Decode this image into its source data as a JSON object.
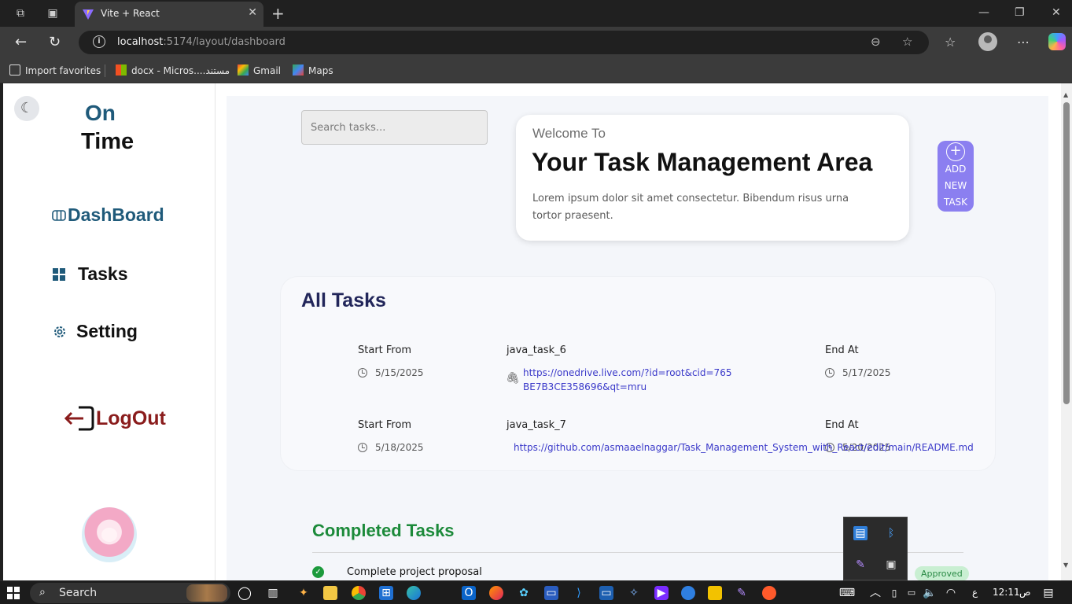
{
  "browser": {
    "tab_title": "Vite + React",
    "url_host": "localhost",
    "url_path": ":5174/layout/dashboard",
    "favorites": [
      {
        "label": "Import favorites"
      },
      {
        "label": "docx - Micros....مستند"
      },
      {
        "label": "Gmail"
      },
      {
        "label": "Maps"
      }
    ]
  },
  "sidebar": {
    "logo_line1": "On",
    "logo_line2": "Time",
    "nav": [
      {
        "label": "DashBoard",
        "icon": "columns-icon",
        "color": "#1f5a7a"
      },
      {
        "label": "Tasks",
        "icon": "grid-icon",
        "color": "#111111"
      },
      {
        "label": "Setting",
        "icon": "gear-icon",
        "color": "#111111"
      }
    ],
    "logout_label": "LogOut"
  },
  "main": {
    "search_placeholder": "Search tasks...",
    "welcome_small": "Welcome To",
    "welcome_title": "Your Task Management Area",
    "welcome_desc": "Lorem ipsum dolor sit amet consectetur. Bibendum risus urna tortor praesent.",
    "add_task_lines": [
      "ADD",
      "NEW",
      "TASK"
    ],
    "all_tasks_title": "All Tasks",
    "tasks": [
      {
        "start_label": "Start From",
        "start_date": "5/15/2025",
        "name": "java_task_6",
        "link": "https://onedrive.live.com/?id=root&cid=765BE7B3CE358696&qt=mru",
        "end_label": "End At",
        "end_date": "5/17/2025"
      },
      {
        "start_label": "Start From",
        "start_date": "5/18/2025",
        "name": "java_task_7",
        "link": "https://github.com/asmaaelnaggar/Task_Management_System_with_React/edit/main/README.md",
        "end_label": "End At",
        "end_date": "5/20/2025"
      }
    ],
    "completed_title": "Completed Tasks",
    "completed": [
      {
        "name": "Complete project proposal",
        "status": "Approved"
      }
    ]
  },
  "taskbar": {
    "search_label": "Search",
    "clock_time": "12:11",
    "clock_ampm": "ص",
    "lang": "ع"
  },
  "colors": {
    "accent": "#8b7ff0",
    "brand": "#1f5a7a",
    "completed": "#1c8a3a",
    "logout": "#8a1c1c",
    "link": "#3a39c9"
  }
}
